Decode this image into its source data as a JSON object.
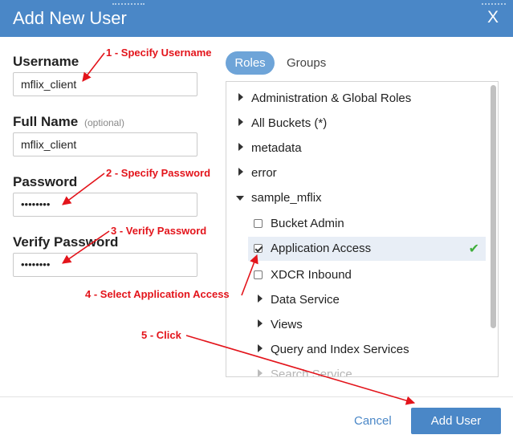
{
  "dialog": {
    "title": "Add New User",
    "close_label": "X"
  },
  "form": {
    "username_label": "Username",
    "username_value": "mflix_client",
    "fullname_label": "Full Name",
    "fullname_optional": "(optional)",
    "fullname_value": "mflix_client",
    "password_label": "Password",
    "password_value": "••••••••",
    "verify_label": "Verify Password",
    "verify_value": "••••••••"
  },
  "tabs": {
    "roles": "Roles",
    "groups": "Groups",
    "active": "Roles"
  },
  "roles_list": [
    {
      "label": "Administration & Global Roles",
      "kind": "collapsed"
    },
    {
      "label": "All Buckets (*)",
      "kind": "collapsed"
    },
    {
      "label": "metadata",
      "kind": "collapsed"
    },
    {
      "label": "error",
      "kind": "collapsed"
    },
    {
      "label": "sample_mflix",
      "kind": "expanded"
    },
    {
      "label": "Bucket Admin",
      "kind": "checkbox",
      "checked": false
    },
    {
      "label": "Application Access",
      "kind": "checkbox",
      "checked": true,
      "selected": true
    },
    {
      "label": "XDCR Inbound",
      "kind": "checkbox",
      "checked": false
    },
    {
      "label": "Data Service",
      "kind": "collapsed-child"
    },
    {
      "label": "Views",
      "kind": "collapsed-child"
    },
    {
      "label": "Query and Index Services",
      "kind": "collapsed-child"
    },
    {
      "label": "Search Service",
      "kind": "collapsed-child",
      "faded": true
    }
  ],
  "footer": {
    "cancel_label": "Cancel",
    "add_label": "Add User"
  },
  "annotations": {
    "step1": "1 - Specify Username",
    "step2": "2 - Specify Password",
    "step3": "3 - Verify Password",
    "step4": "4 - Select Application Access",
    "step5": "5 - Click"
  },
  "colors": {
    "header": "#4a87c7",
    "primary_button": "#4a87c7",
    "annotation": "#e3141b",
    "success_check": "#3fae3a"
  }
}
